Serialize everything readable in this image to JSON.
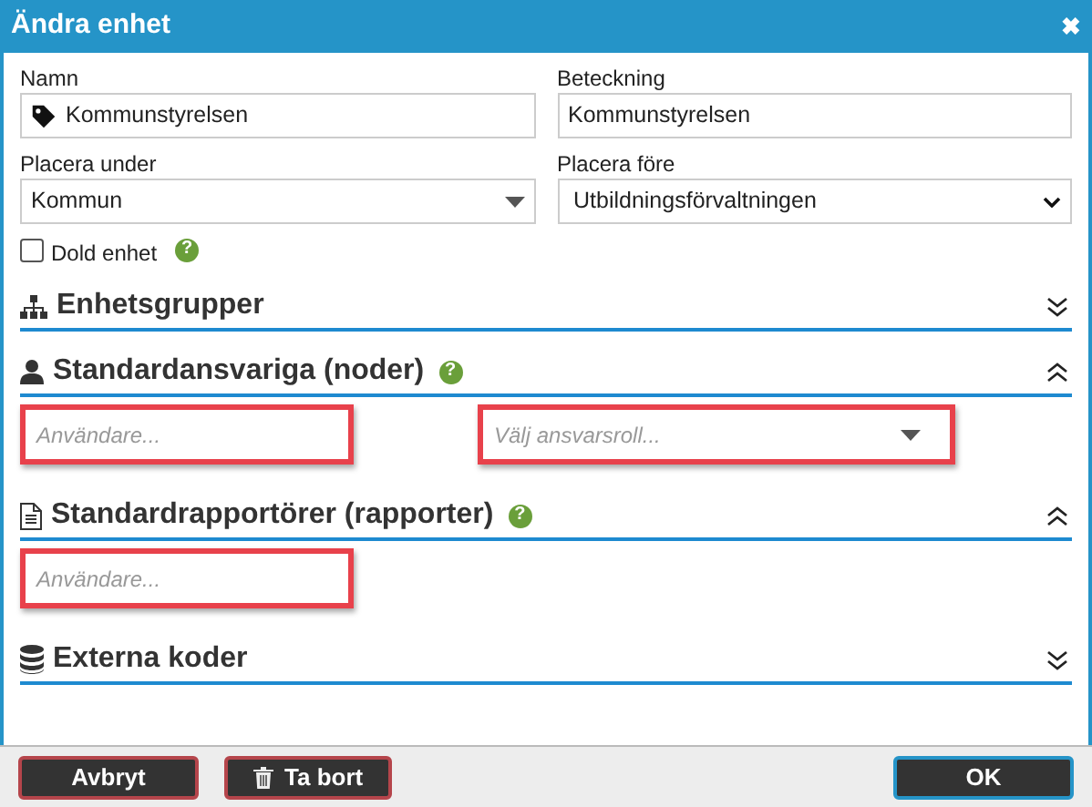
{
  "dialog": {
    "title": "Ändra enhet",
    "close": "✖"
  },
  "fields": [
    {
      "label": "Namn",
      "kind": "text",
      "value": "Kommunstyrelsen"
    },
    {
      "label": "Beteckning",
      "kind": "text",
      "value": "Kommunstyrelsen"
    },
    {
      "label": "Placera under",
      "kind": "combo",
      "value": "Kommun"
    },
    {
      "label": "Placera före",
      "kind": "select",
      "value": "Utbildningsförvaltningen"
    }
  ],
  "hidden_unit": {
    "label": "Dold enhet",
    "checked": false,
    "help": "?"
  },
  "sections": [
    {
      "title": "Enhetsgrupper",
      "expanded": false
    },
    {
      "title": "Standardansvariga (noder)",
      "help": "?",
      "expanded": true,
      "fields": [
        {
          "kind": "text",
          "placeholder": "Användare...",
          "highlighted": true
        },
        {
          "kind": "combo",
          "placeholder": "Välj ansvarsroll...",
          "highlighted": true
        }
      ]
    },
    {
      "title": "Standardrapportörer (rapporter)",
      "help": "?",
      "expanded": true,
      "fields": [
        {
          "kind": "text",
          "placeholder": "Användare...",
          "highlighted": true
        }
      ]
    },
    {
      "title": "Externa koder",
      "expanded": false
    }
  ],
  "buttons": [
    {
      "label": "Avbryt",
      "kind": "danger"
    },
    {
      "label": "Ta bort",
      "kind": "delete"
    },
    {
      "label": "OK",
      "kind": "primary"
    }
  ]
}
